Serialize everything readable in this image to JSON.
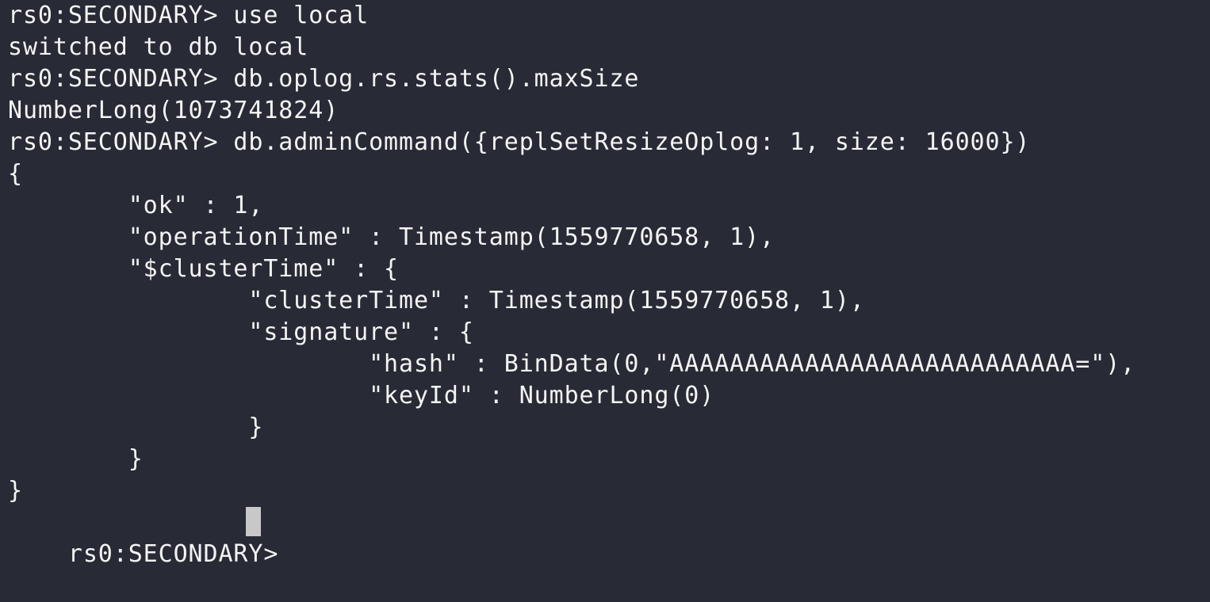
{
  "colors": {
    "background": "#282a36",
    "foreground": "#f4f4f4",
    "cursor": "#c8c8c8"
  },
  "prompt": "rs0:SECONDARY> ",
  "lines": [
    "rs0:SECONDARY> use local",
    "switched to db local",
    "rs0:SECONDARY> db.oplog.rs.stats().maxSize",
    "NumberLong(1073741824)",
    "rs0:SECONDARY> db.adminCommand({replSetResizeOplog: 1, size: 16000})",
    "{",
    "        \"ok\" : 1,",
    "        \"operationTime\" : Timestamp(1559770658, 1),",
    "        \"$clusterTime\" : {",
    "                \"clusterTime\" : Timestamp(1559770658, 1),",
    "                \"signature\" : {",
    "                        \"hash\" : BinData(0,\"AAAAAAAAAAAAAAAAAAAAAAAAAAA=\"),",
    "                        \"keyId\" : NumberLong(0)",
    "                }",
    "        }",
    "}"
  ]
}
